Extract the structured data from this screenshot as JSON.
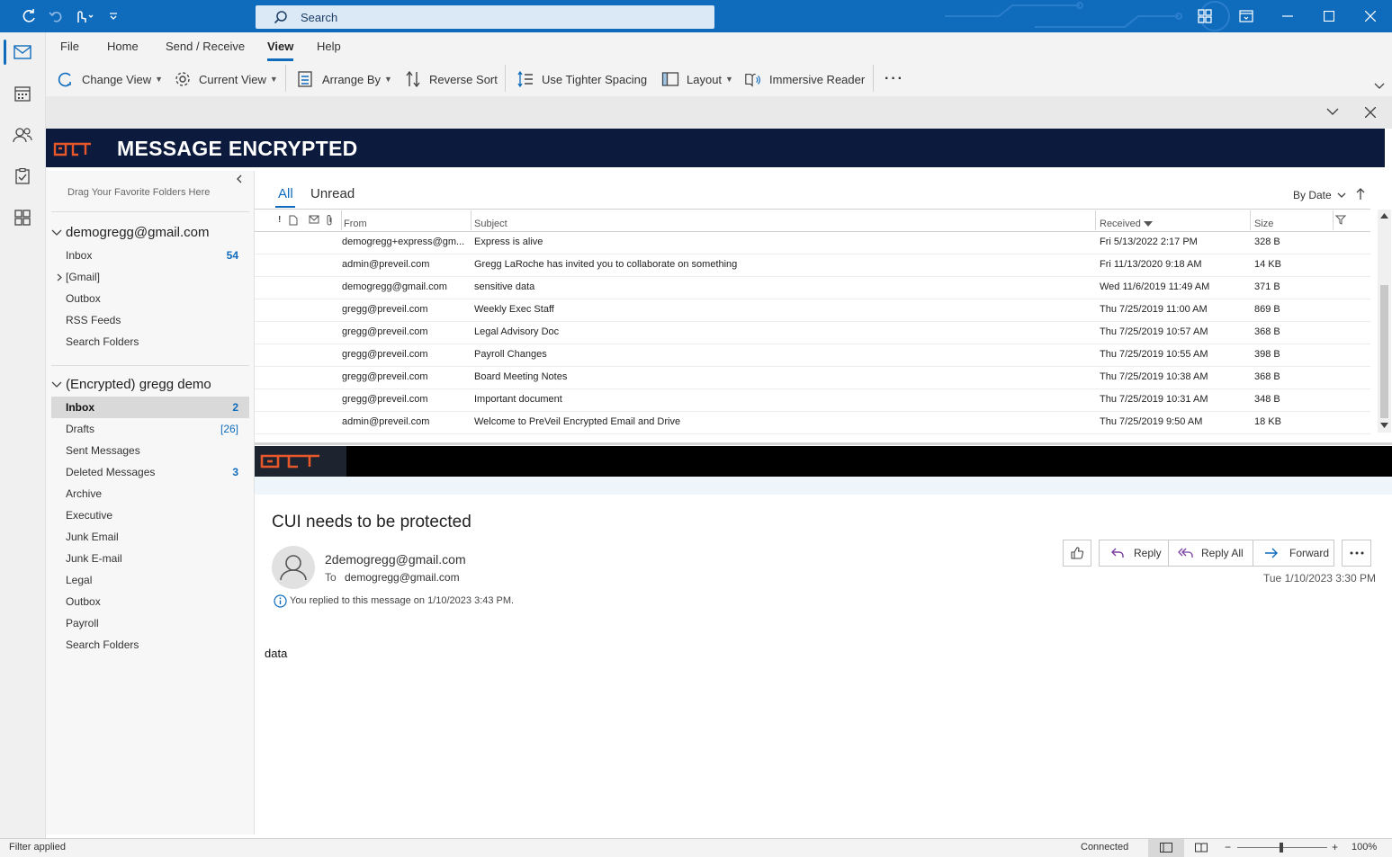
{
  "titlebar": {
    "search_placeholder": "Search"
  },
  "ribbon": {
    "tabs": [
      "File",
      "Home",
      "Send / Receive",
      "View",
      "Help"
    ],
    "active_tab": "View",
    "buttons": {
      "change_view": "Change View",
      "current_view": "Current View",
      "arrange_by": "Arrange By",
      "reverse_sort": "Reverse Sort",
      "tighter_spacing": "Use Tighter Spacing",
      "layout": "Layout",
      "immersive_reader": "Immersive Reader",
      "more": "···"
    }
  },
  "banner": {
    "title": "MESSAGE ENCRYPTED"
  },
  "folders": {
    "drag_hint": "Drag Your Favorite Folders Here",
    "account1": {
      "name": "demogregg@gmail.com",
      "items": [
        {
          "name": "Inbox",
          "count": "54"
        },
        {
          "name": "[Gmail]",
          "count": ""
        },
        {
          "name": "Outbox",
          "count": ""
        },
        {
          "name": "RSS Feeds",
          "count": ""
        },
        {
          "name": "Search Folders",
          "count": ""
        }
      ]
    },
    "account2": {
      "name": "(Encrypted) gregg demo",
      "items": [
        {
          "name": "Inbox",
          "count": "2"
        },
        {
          "name": "Drafts",
          "count": "[26]"
        },
        {
          "name": "Sent Messages",
          "count": ""
        },
        {
          "name": "Deleted Messages",
          "count": "3"
        },
        {
          "name": "Archive",
          "count": ""
        },
        {
          "name": "Executive",
          "count": ""
        },
        {
          "name": "Junk Email",
          "count": ""
        },
        {
          "name": "Junk E-mail",
          "count": ""
        },
        {
          "name": "Legal",
          "count": ""
        },
        {
          "name": "Outbox",
          "count": ""
        },
        {
          "name": "Payroll",
          "count": ""
        },
        {
          "name": "Search Folders",
          "count": ""
        }
      ]
    }
  },
  "message_list": {
    "filter_tabs": [
      "All",
      "Unread"
    ],
    "sort_label": "By Date",
    "columns": {
      "from": "From",
      "subject": "Subject",
      "received": "Received",
      "size": "Size"
    },
    "rows": [
      {
        "from": "demogregg+express@gm...",
        "subject": "Express is alive",
        "received": "Fri 5/13/2022 2:17 PM",
        "size": "328 B"
      },
      {
        "from": "admin@preveil.com",
        "subject": "Gregg LaRoche  has invited you to collaborate on something",
        "received": "Fri 11/13/2020 9:18 AM",
        "size": "14 KB"
      },
      {
        "from": "demogregg@gmail.com",
        "subject": "sensitive data",
        "received": "Wed 11/6/2019 11:49 AM",
        "size": "371 B"
      },
      {
        "from": "gregg@preveil.com",
        "subject": "Weekly Exec Staff",
        "received": "Thu 7/25/2019 11:00 AM",
        "size": "869 B"
      },
      {
        "from": "gregg@preveil.com",
        "subject": "Legal Advisory Doc",
        "received": "Thu 7/25/2019 10:57 AM",
        "size": "368 B"
      },
      {
        "from": "gregg@preveil.com",
        "subject": "Payroll Changes",
        "received": "Thu 7/25/2019 10:55 AM",
        "size": "398 B"
      },
      {
        "from": "gregg@preveil.com",
        "subject": "Board Meeting Notes",
        "received": "Thu 7/25/2019 10:38 AM",
        "size": "368 B"
      },
      {
        "from": "gregg@preveil.com",
        "subject": "Important document",
        "received": "Thu 7/25/2019 10:31 AM",
        "size": "348 B"
      },
      {
        "from": "admin@preveil.com",
        "subject": "Welcome to PreVeil Encrypted Email and Drive",
        "received": "Thu 7/25/2019 9:50 AM",
        "size": "18 KB"
      }
    ]
  },
  "reading": {
    "subject": "CUI needs to be protected",
    "sender": "2demogregg@gmail.com",
    "to_label": "To",
    "to": "demogregg@gmail.com",
    "replied_note": "You replied to this message on 1/10/2023 3:43 PM.",
    "date": "Tue 1/10/2023 3:30 PM",
    "body": "data",
    "buttons": {
      "reply": "Reply",
      "reply_all": "Reply All",
      "forward": "Forward"
    }
  },
  "statusbar": {
    "left": "Filter applied",
    "connection": "Connected",
    "zoom": "100%"
  },
  "colors": {
    "accent": "#0f6cbd",
    "banner_bg": "#0b1a3d",
    "logo_orange": "#e8572a"
  }
}
